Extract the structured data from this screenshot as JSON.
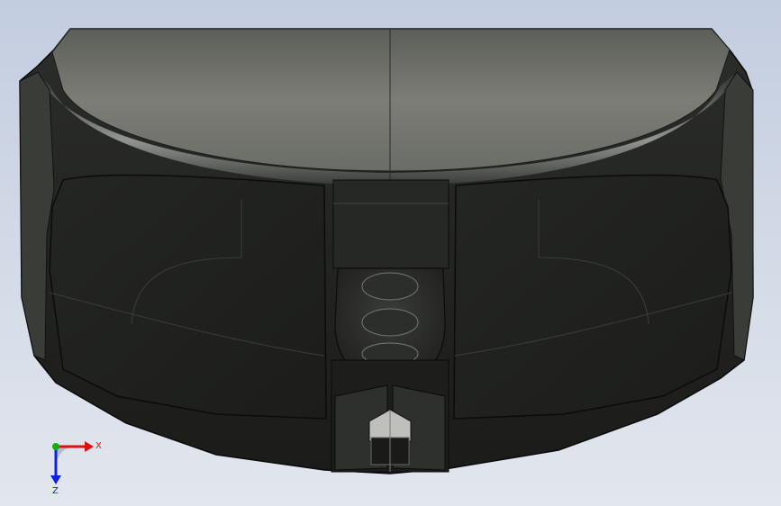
{
  "viewport": {
    "background_top": "#c3cde0",
    "background_bottom": "#e2e6ee"
  },
  "model": {
    "body_color": "#2a2c2a",
    "top_surface_color": "#6f716b",
    "edge_color": "#0e0f0e",
    "highlight_color": "#a9aca4"
  },
  "triad": {
    "x_label": "X",
    "z_label": "Z",
    "x_color": "#e01010",
    "y_color": "#10b010",
    "z_color": "#1020e0"
  }
}
